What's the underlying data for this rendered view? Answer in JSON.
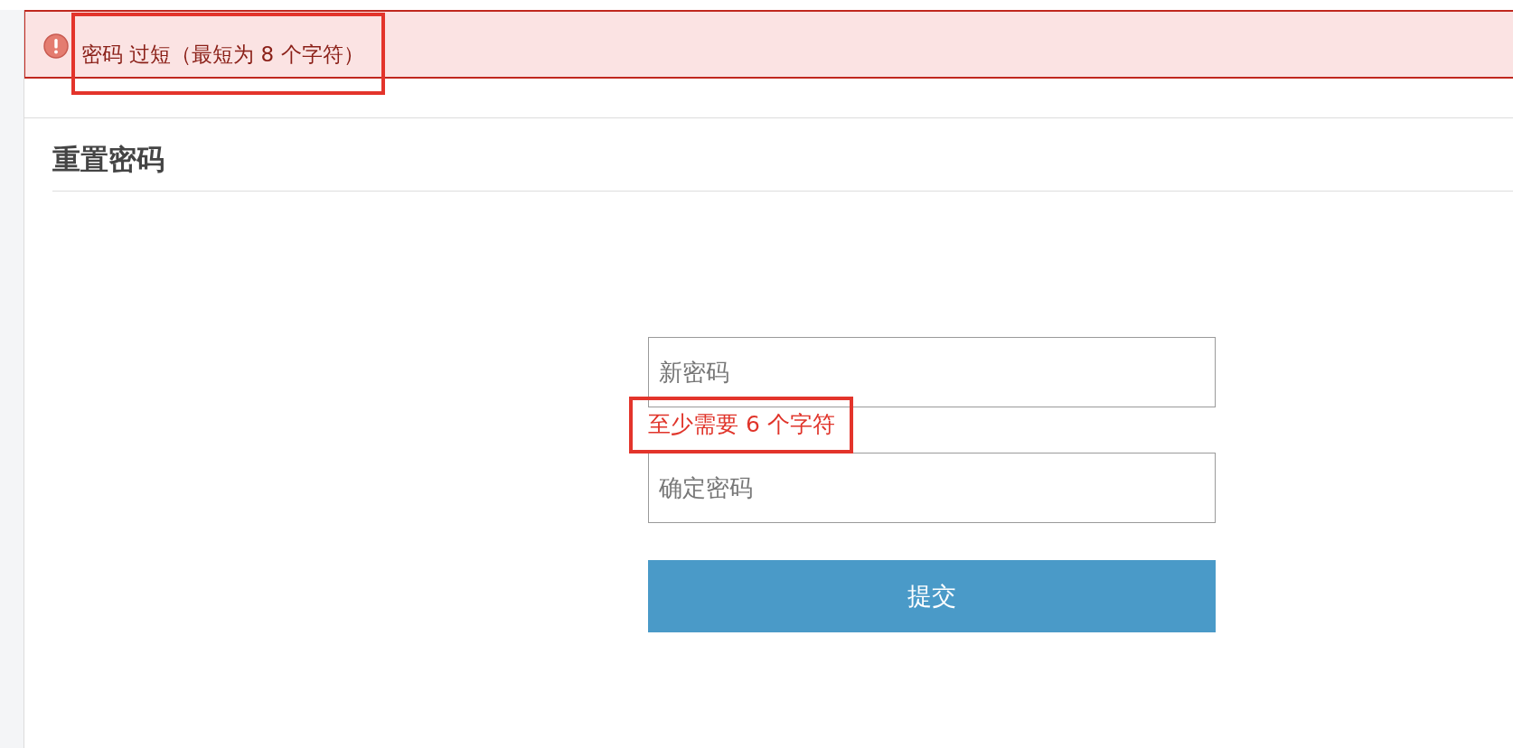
{
  "alert": {
    "message": "密码 过短（最短为 8 个字符）",
    "highlighted": true
  },
  "panel": {
    "title": "重置密码"
  },
  "form": {
    "fields": [
      {
        "placeholder": "新密码",
        "error": "至少需要 6 个字符",
        "error_highlighted": true
      },
      {
        "placeholder": "确定密码"
      }
    ],
    "submit_button": "提交"
  }
}
